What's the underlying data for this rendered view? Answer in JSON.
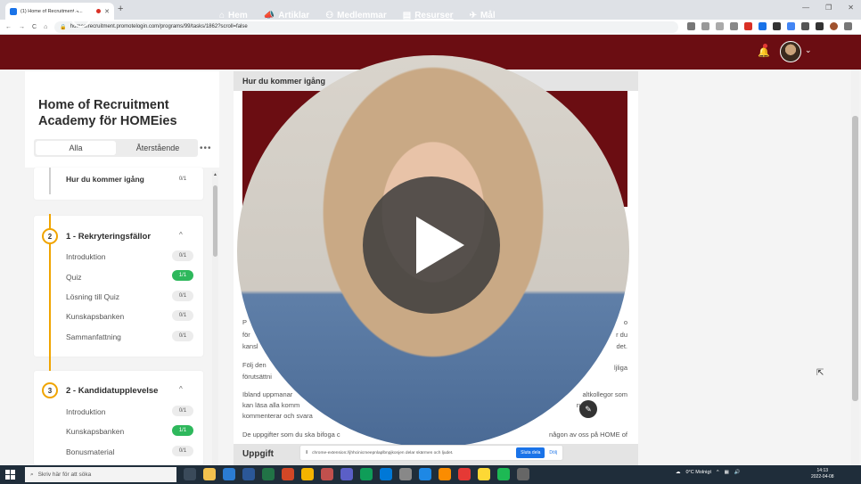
{
  "browser": {
    "tab_title": "(1) Home of Recruitment A...",
    "url": "homeofrecruitment.promotelogin.com/programs/99/tasks/1862?scroll=false"
  },
  "nav": {
    "items": [
      {
        "label": "Hem",
        "icon": "home-icon"
      },
      {
        "label": "Artiklar",
        "icon": "megaphone-icon"
      },
      {
        "label": "Medlemmar",
        "icon": "users-icon"
      },
      {
        "label": "Resurser",
        "icon": "resource-icon"
      },
      {
        "label": "Mål",
        "icon": "flag-icon"
      }
    ]
  },
  "sidebar": {
    "course_title": "Home of Recruitment Academy för HOMEies",
    "filter": {
      "all": "Alla",
      "remaining": "Återstående"
    },
    "first_item": {
      "label": "Hur du kommer igång",
      "progress": "0/1"
    },
    "sections": [
      {
        "number": "2",
        "title": "1 - Rekryteringsfällor",
        "lessons": [
          {
            "label": "Introduktion",
            "progress": "0/1",
            "done": false
          },
          {
            "label": "Quiz",
            "progress": "1/1",
            "done": true
          },
          {
            "label": "Lösning till Quiz",
            "progress": "0/1",
            "done": false
          },
          {
            "label": "Kunskapsbanken",
            "progress": "0/1",
            "done": false
          },
          {
            "label": "Sammanfattning",
            "progress": "0/1",
            "done": false
          }
        ]
      },
      {
        "number": "3",
        "title": "2 - Kandidatupplevelse",
        "lessons": [
          {
            "label": "Introduktion",
            "progress": "0/1",
            "done": false
          },
          {
            "label": "Kunskapsbanken",
            "progress": "1/1",
            "done": true
          },
          {
            "label": "Bonusmaterial",
            "progress": "0/1",
            "done": false
          }
        ]
      }
    ]
  },
  "content": {
    "title": "Hur du kommer igång",
    "paragraphs": [
      "P",
      "för",
      "kansl",
      "Följ den",
      "förutsättni",
      "Ibland uppmanar",
      "kan läsa alla komm",
      "kommenterar och svara",
      "De uppgifter som du ska bifoga c"
    ],
    "right_fragments": [
      "o",
      "r du",
      "det.",
      "ljliga",
      "altkollegor som",
      "rume",
      "någon av oss på HOME of"
    ],
    "task_heading": "Uppgift"
  },
  "share_bar": {
    "text": "chrome-extension://jhhcinicmeepnlaplbnpjkonjen delar skärmen och ljudet.",
    "stop": "Sluta dela",
    "hide": "Dölj"
  },
  "taskbar": {
    "search_placeholder": "Skriv här för att söka",
    "weather": "0°C Molnigt",
    "time": "14:13",
    "date": "2022-04-08"
  },
  "colors": {
    "brand": "#6b0d12",
    "accent": "#f0a400",
    "done": "#2eb85c"
  }
}
